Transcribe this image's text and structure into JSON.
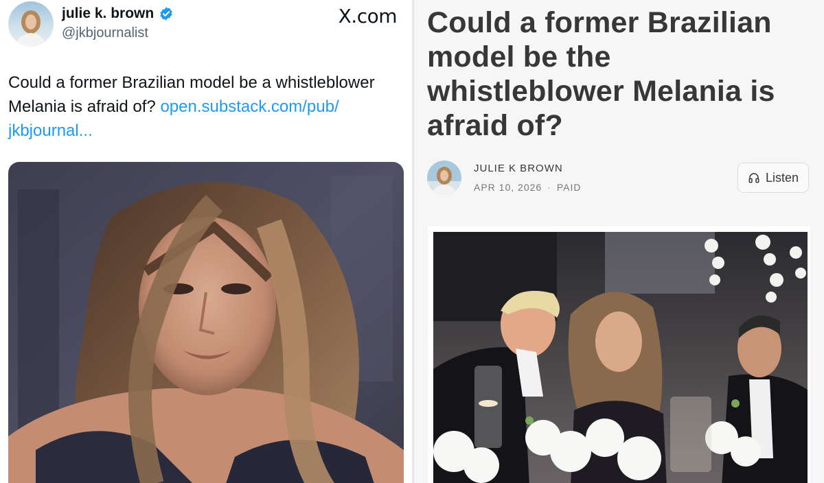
{
  "tweet": {
    "author_name": "julie k. brown",
    "handle": "@jkbjournalist",
    "platform": "X.com",
    "text": "Could a former Brazilian model be a whistleblower Melania is afraid of? ",
    "link_text": "open.substack.com/pub/​jkbjournal...",
    "icons": {
      "verified": "verified-badge-icon"
    },
    "colors": {
      "link": "#1d9bf0",
      "verified": "#1d9bf0"
    }
  },
  "article": {
    "title": "Could a former Brazilian model be the whistleblower Melania is afraid of?",
    "author": "JULIE K BROWN",
    "date": "APR 10, 2026",
    "separator": "·",
    "access": "PAID",
    "listen_label": "Listen",
    "icons": {
      "listen": "headphones-icon"
    }
  }
}
